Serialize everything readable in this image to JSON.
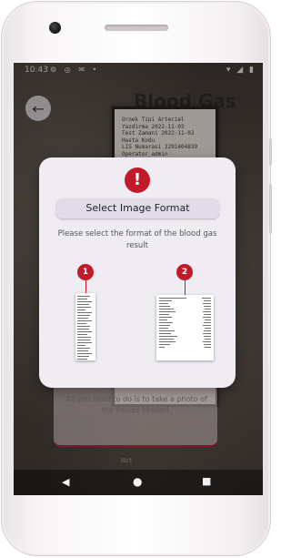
{
  "status_bar": {
    "time": "10:43",
    "left_icons": "⚙ ◎ ✉ •",
    "right_icons": "▾ ◢ ▮"
  },
  "page": {
    "title": "Blood Gas",
    "back_icon": "arrow-left-icon",
    "info_text": "All you need to do is to take a photo of the values needed."
  },
  "receipt": {
    "lines": [
      "Ornek Tipi  Arteriel",
      "Yazdirma    2022-11-03",
      "Test Zamani 2022-11-03",
      "Hasta Kodu",
      "LIS Numarasi 2291404839",
      "Operator    admin"
    ],
    "footer": "Not"
  },
  "dialog": {
    "title": "Select Image Format",
    "message": "Please select the format of the blood gas result",
    "alert_icon": "!",
    "options": [
      {
        "number": "1",
        "format": "narrow-receipt"
      },
      {
        "number": "2",
        "format": "wide-report"
      }
    ]
  },
  "nav": {
    "back": "◀",
    "home": "●",
    "recent": "■"
  },
  "colors": {
    "accent": "#c21a2b",
    "dialog_bg": "#efedf2"
  }
}
